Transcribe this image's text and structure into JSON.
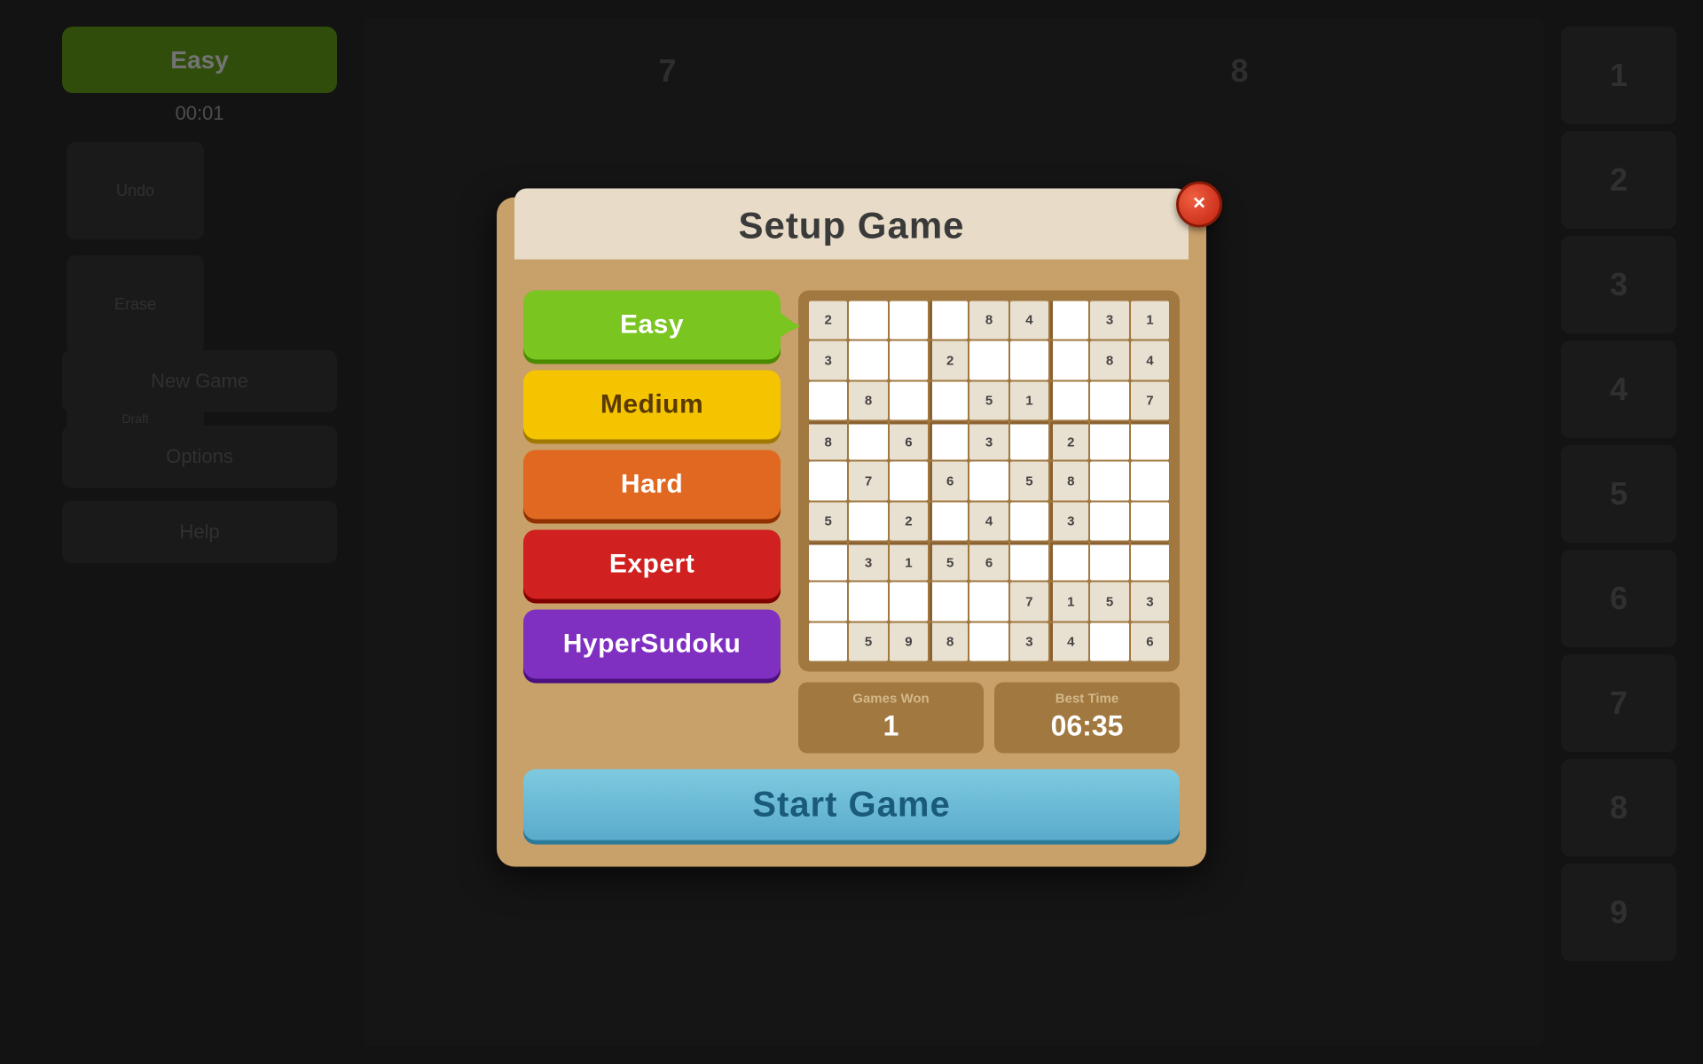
{
  "background": {
    "easy_label": "Easy",
    "timer": "00:01",
    "undo_label": "Undo",
    "erase_label": "Erase",
    "draft_mode_label": "Draft\nMode",
    "new_game_label": "New Game",
    "options_label": "Options",
    "help_label": "Help",
    "right_numbers": [
      "1",
      "2",
      "3",
      "4",
      "5",
      "6",
      "7",
      "8",
      "9"
    ]
  },
  "modal": {
    "title": "Setup Game",
    "close_label": "×",
    "difficulty_buttons": [
      {
        "id": "easy",
        "label": "Easy",
        "selected": true
      },
      {
        "id": "medium",
        "label": "Medium",
        "selected": false
      },
      {
        "id": "hard",
        "label": "Hard",
        "selected": false
      },
      {
        "id": "expert",
        "label": "Expert",
        "selected": false
      },
      {
        "id": "hypersudoku",
        "label": "HyperSudoku",
        "selected": false
      }
    ],
    "stats": {
      "games_won_label": "Games Won",
      "games_won_value": "1",
      "best_time_label": "Best Time",
      "best_time_value": "06:35"
    },
    "start_button_label": "Start Game",
    "sudoku_grid": [
      [
        "2",
        "",
        "",
        "",
        "8",
        "4",
        "",
        "3",
        "1"
      ],
      [
        "3",
        "",
        "",
        "2",
        "",
        "",
        "",
        "8",
        "4"
      ],
      [
        "",
        "8",
        "",
        "",
        "5",
        "1",
        "",
        "",
        "7"
      ],
      [
        "8",
        "",
        "6",
        "",
        "3",
        "",
        "2",
        "",
        ""
      ],
      [
        "",
        "7",
        "",
        "6",
        "",
        "5",
        "8",
        "",
        ""
      ],
      [
        "5",
        "",
        "2",
        "",
        "4",
        "",
        "3",
        "",
        ""
      ],
      [
        "",
        "3",
        "1",
        "5",
        "6",
        "",
        "",
        "",
        ""
      ],
      [
        "",
        "",
        "",
        "",
        "",
        "7",
        "1",
        "5",
        "3"
      ],
      [
        "",
        "5",
        "9",
        "8",
        "",
        "3",
        "4",
        "",
        "6"
      ]
    ]
  }
}
